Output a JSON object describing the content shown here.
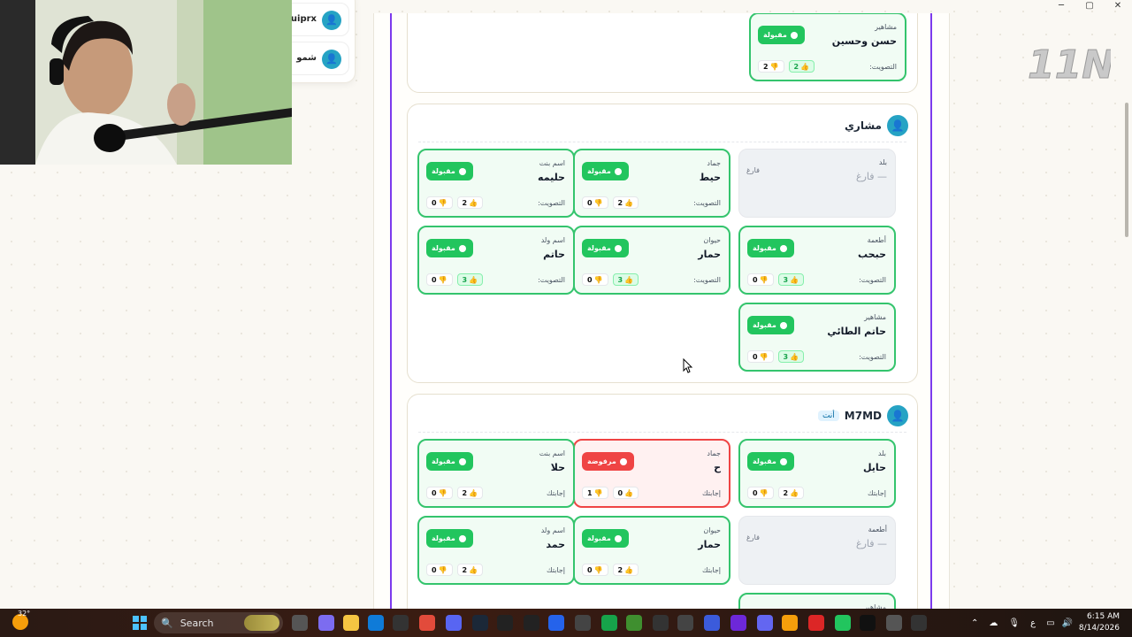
{
  "window": {
    "minimize": "─",
    "maximize": "▢",
    "close": "✕"
  },
  "logo": {
    "text": "11N"
  },
  "players": [
    {
      "name": "uiprx"
    },
    {
      "name": "شمو"
    }
  ],
  "sections": [
    {
      "cards": [
        {
          "cat": "مشاهير",
          "word": "حسن وحسين",
          "status": "مقبولة",
          "vote_label": "التصويت:",
          "up": "2",
          "down": "2",
          "up_hl": true
        }
      ]
    },
    {
      "player": "مشاري",
      "cards": [
        {
          "cat": "بلد",
          "word": "— فارغ",
          "empty": true,
          "empty_tag": "فارغ"
        },
        {
          "cat": "جماد",
          "word": "حيط",
          "status": "مقبولة",
          "vote_label": "التصويت:",
          "up": "2",
          "down": "0",
          "up_hl": false
        },
        {
          "cat": "اسم بنت",
          "word": "حليمه",
          "status": "مقبولة",
          "vote_label": "التصويت:",
          "up": "2",
          "down": "0",
          "up_hl": false
        },
        {
          "cat": "أطعمة",
          "word": "حبحب",
          "status": "مقبولة",
          "vote_label": "التصويت:",
          "up": "3",
          "down": "0",
          "up_hl": true
        },
        {
          "cat": "حيوان",
          "word": "حمار",
          "status": "مقبولة",
          "vote_label": "التصويت:",
          "up": "3",
          "down": "0",
          "up_hl": true
        },
        {
          "cat": "اسم ولد",
          "word": "حاتم",
          "status": "مقبولة",
          "vote_label": "التصويت:",
          "up": "3",
          "down": "0",
          "up_hl": true
        },
        {
          "cat": "مشاهير",
          "word": "حاتم الطائي",
          "status": "مقبولة",
          "vote_label": "التصويت:",
          "up": "3",
          "down": "0",
          "up_hl": true
        }
      ]
    },
    {
      "player": "M7MD",
      "you_badge": "أنت",
      "cards": [
        {
          "cat": "بلد",
          "word": "حايل",
          "status": "مقبولة",
          "vote_label": "إجابتك",
          "up": "2",
          "down": "0"
        },
        {
          "cat": "جماد",
          "word": "ح",
          "status": "مرفوضة",
          "rejected": true,
          "vote_label": "إجابتك",
          "up": "0",
          "down": "1"
        },
        {
          "cat": "اسم بنت",
          "word": "حلا",
          "status": "مقبولة",
          "vote_label": "إجابتك",
          "up": "2",
          "down": "0"
        },
        {
          "cat": "أطعمة",
          "word": "— فارغ",
          "empty": true,
          "empty_tag": "فارغ"
        },
        {
          "cat": "حيوان",
          "word": "حمار",
          "status": "مقبولة",
          "vote_label": "إجابتك",
          "up": "2",
          "down": "0"
        },
        {
          "cat": "اسم ولد",
          "word": "حمد",
          "status": "مقبولة",
          "vote_label": "إجابتك",
          "up": "2",
          "down": "0"
        },
        {
          "cat": "مشاهير"
        }
      ]
    }
  ],
  "taskbar": {
    "temp": "32°",
    "search_label": "Search",
    "lang": "ع",
    "time": "6:15 AM",
    "date": "8/14/2026"
  }
}
